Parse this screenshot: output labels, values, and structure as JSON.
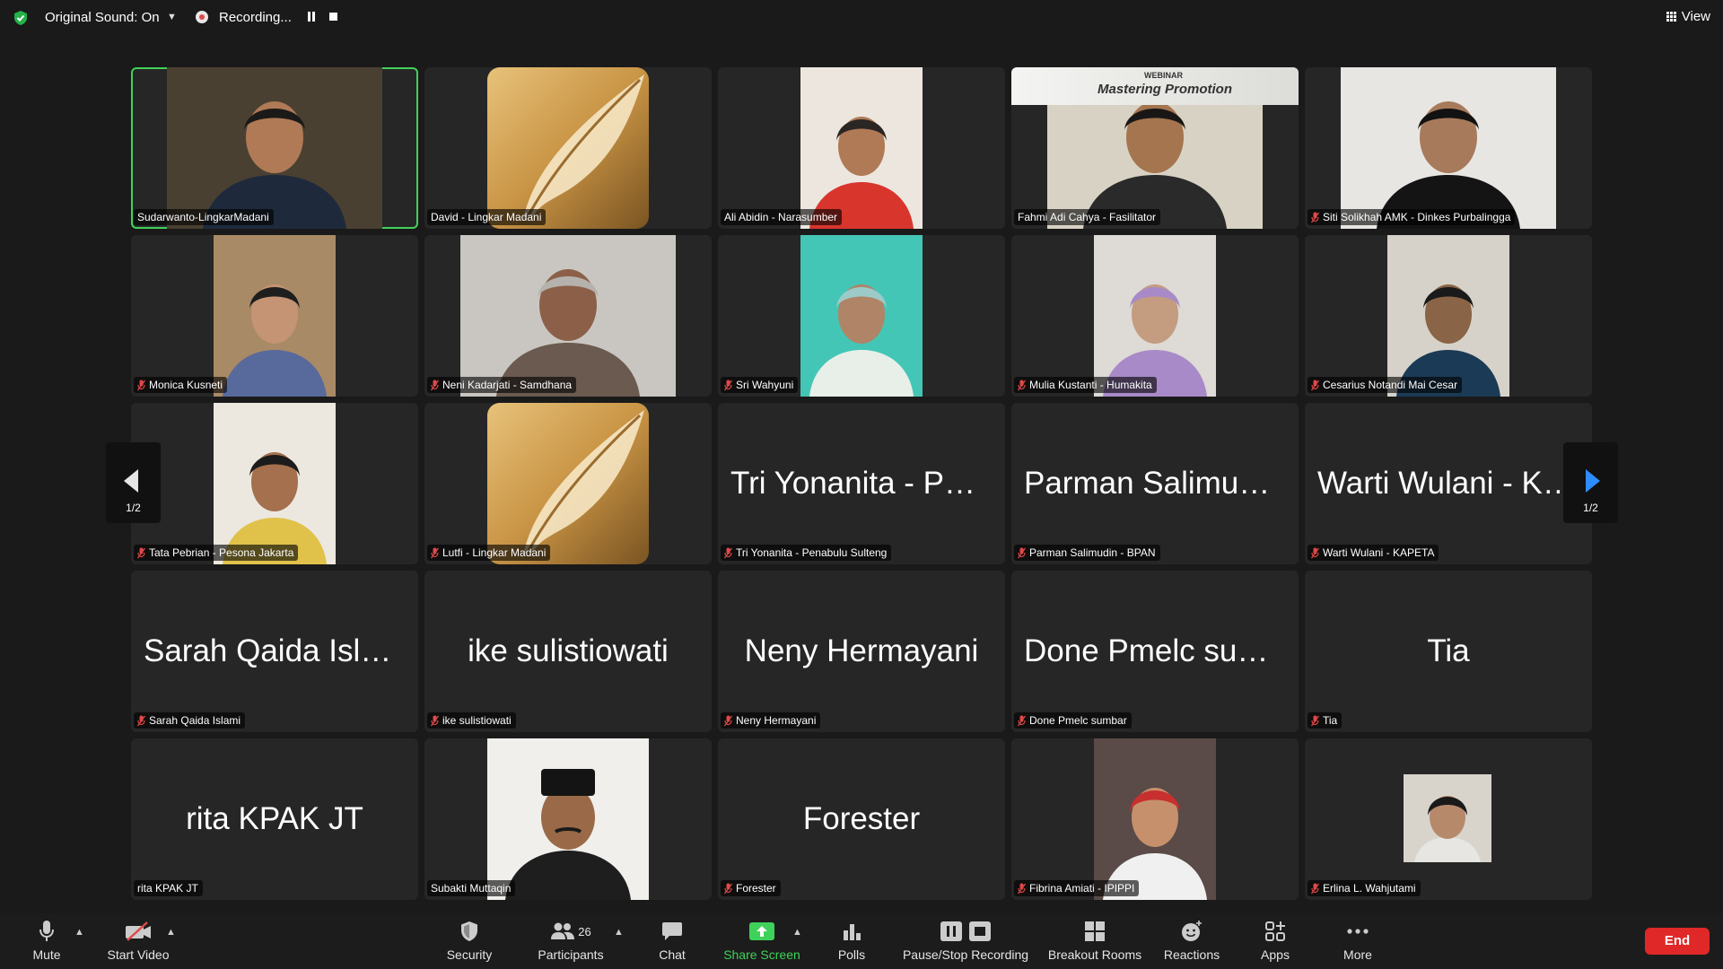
{
  "topbar": {
    "original_sound": "Original Sound: On",
    "recording": "Recording...",
    "view": "View"
  },
  "pager": {
    "left": "1/2",
    "right": "1/2"
  },
  "tiles": [
    {
      "label": "Sudarwanto-LingkarMadani",
      "muted": false,
      "video": "webcam",
      "active": true
    },
    {
      "label": "David - Lingkar Madani",
      "muted": false,
      "video": "feather-logo"
    },
    {
      "label": "Ali Abidin - Narasumber",
      "muted": false,
      "video": "webcam"
    },
    {
      "label": "Fahmi Adi Cahya - Fasilitator",
      "muted": false,
      "video": "webcam-banner",
      "banner_text": "Mastering Promotion",
      "banner_tag": "WEBINAR"
    },
    {
      "label": "Siti Solikhah AMK - Dinkes Purbalingga",
      "muted": true,
      "video": "webcam"
    },
    {
      "label": "Monica Kusneti",
      "muted": true,
      "video": "webcam"
    },
    {
      "label": "Neni Kadarjati - Samdhana",
      "muted": true,
      "video": "webcam"
    },
    {
      "label": "Sri Wahyuni",
      "muted": true,
      "video": "webcam"
    },
    {
      "label": "Mulia Kustanti - Humakita",
      "muted": true,
      "video": "webcam"
    },
    {
      "label": "Cesarius Notandi Mai Cesar",
      "muted": true,
      "video": "webcam"
    },
    {
      "label": "Tata Pebrian - Pesona Jakarta",
      "muted": true,
      "video": "webcam"
    },
    {
      "label": "Lutfi - Lingkar Madani",
      "muted": true,
      "video": "feather-logo"
    },
    {
      "label": "Tri Yonanita - Penabulu Sulteng",
      "muted": true,
      "video": "none",
      "display_name": "Tri Yonanita - Pen..."
    },
    {
      "label": "Parman Salimudin - BPAN",
      "muted": true,
      "video": "none",
      "display_name": "Parman Salimudin..."
    },
    {
      "label": "Warti Wulani - KAPETA",
      "muted": true,
      "video": "none",
      "display_name": "Warti Wulani - KA..."
    },
    {
      "label": "Sarah Qaida Islami",
      "muted": true,
      "video": "none",
      "display_name": "Sarah Qaida Islami"
    },
    {
      "label": "ike sulistiowati",
      "muted": true,
      "video": "none",
      "display_name": "ike sulistiowati"
    },
    {
      "label": "Neny Hermayani",
      "muted": true,
      "video": "none",
      "display_name": "Neny Hermayani"
    },
    {
      "label": "Done Pmelc sumbar",
      "muted": true,
      "video": "none",
      "display_name": "Done Pmelc sumb..."
    },
    {
      "label": "Tia",
      "muted": true,
      "video": "none",
      "display_name": "Tia"
    },
    {
      "label": "rita KPAK JT",
      "muted": false,
      "video": "none",
      "display_name": "rita KPAK JT"
    },
    {
      "label": "Subakti Muttaqin",
      "muted": false,
      "video": "portrait"
    },
    {
      "label": "Forester",
      "muted": true,
      "video": "none",
      "display_name": "Forester"
    },
    {
      "label": "Fibrina Amiati - IPIPPI",
      "muted": true,
      "video": "webcam"
    },
    {
      "label": "Erlina L. Wahjutami",
      "muted": true,
      "video": "avatar"
    }
  ],
  "toolbar": {
    "mute": "Mute",
    "start_video": "Start Video",
    "security": "Security",
    "participants": "Participants",
    "participants_count": "26",
    "chat": "Chat",
    "share_screen": "Share Screen",
    "polls": "Polls",
    "recording": "Pause/Stop Recording",
    "breakout": "Breakout Rooms",
    "reactions": "Reactions",
    "apps": "Apps",
    "more": "More",
    "end": "End"
  },
  "colors": {
    "background": "#1a1a1a",
    "tile": "#262626",
    "active_speaker": "#3fd25a",
    "share_green": "#3fd25a",
    "end_red": "#e02828",
    "muted_red": "#e04848",
    "pager_blue": "#2d8cff"
  }
}
